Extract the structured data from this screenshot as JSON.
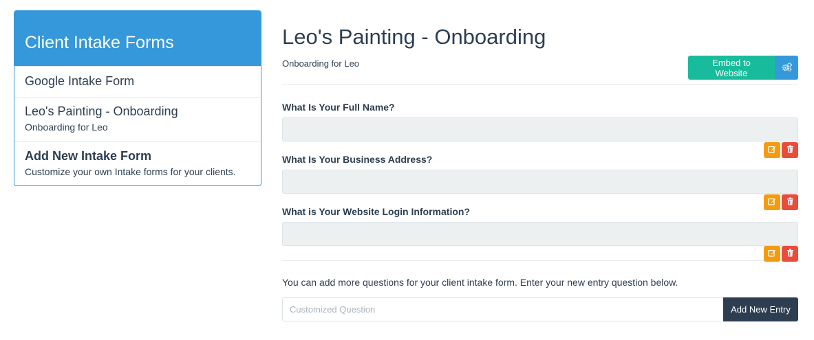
{
  "sidebar": {
    "title": "Client Intake Forms",
    "items": [
      {
        "label": "Google Intake Form"
      },
      {
        "label": "Leo's Painting - Onboarding",
        "subtitle": "Onboarding for Leo"
      },
      {
        "label": "Add New Intake Form",
        "subtitle": "Customize your own Intake forms for your clients."
      }
    ]
  },
  "form": {
    "title": "Leo's Painting - Onboarding",
    "subtitle": "Onboarding for Leo",
    "embed_label": "Embed to Website",
    "settings_icon": "gears-icon",
    "questions": [
      {
        "label": "What Is Your Full Name?"
      },
      {
        "label": "What Is Your Business Address?"
      },
      {
        "label": "What is Your Website Login Information?"
      }
    ],
    "edit_icon": "edit-icon",
    "delete_icon": "trash-icon",
    "helper_text": "You can add more questions for your client intake form. Enter your new entry question below.",
    "new_question_placeholder": "Customized Question",
    "add_entry_label": "Add New Entry"
  },
  "colors": {
    "primary": "#3498db",
    "success": "#18bc9c",
    "warning": "#f39c12",
    "danger": "#e74c3c",
    "dark": "#2c3e50"
  }
}
